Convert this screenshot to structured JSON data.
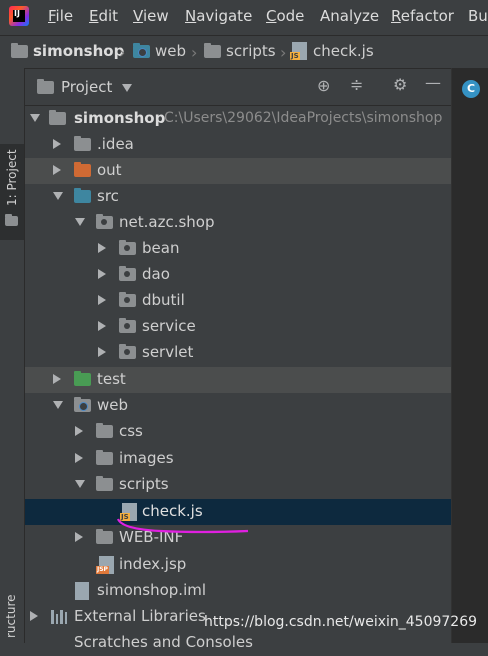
{
  "menu": {
    "items": [
      {
        "label": "File",
        "u": "F",
        "rest": "ile"
      },
      {
        "label": "Edit",
        "u": "E",
        "rest": "dit"
      },
      {
        "label": "View",
        "u": "V",
        "rest": "iew"
      },
      {
        "label": "Navigate",
        "u": "N",
        "rest": "avigate"
      },
      {
        "label": "Code",
        "u": "C",
        "rest": "ode"
      },
      {
        "label": "Analyze",
        "u": "",
        "rest": "Analyze"
      },
      {
        "label": "Refactor",
        "u": "R",
        "rest": "efactor"
      },
      {
        "label": "Bu",
        "u": "",
        "rest": "Bu"
      }
    ]
  },
  "breadcrumb": {
    "project": "simonshop",
    "web": "web",
    "scripts": "scripts",
    "file": "check.js"
  },
  "left_strip": {
    "project_tab": "1: Project",
    "structure_tab": "ructure"
  },
  "panel": {
    "title": "Project",
    "dropdown_icon": "chevron-down-icon"
  },
  "tree": {
    "root_name": "simonshop",
    "root_path": "C:\\Users\\29062\\IdeaProjects\\simonshop",
    "idea": ".idea",
    "out": "out",
    "src": "src",
    "pkg": "net.azc.shop",
    "bean": "bean",
    "dao": "dao",
    "dbutil": "dbutil",
    "service": "service",
    "servlet": "servlet",
    "test": "test",
    "web": "web",
    "css": "css",
    "images": "images",
    "scripts": "scripts",
    "checkjs": "check.js",
    "webinf": "WEB-INF",
    "indexjsp": "index.jsp",
    "iml": "simonshop.iml",
    "extlib": "External Libraries",
    "scratches": "Scratches and Consoles"
  },
  "badges": {
    "js": "JS",
    "jsp": "JSP"
  },
  "watermark": "https://blog.csdn.net/weixin_45097269",
  "colors": {
    "background": "#3c3f41",
    "selection": "#0d293e",
    "annotation": "#e020e0"
  }
}
